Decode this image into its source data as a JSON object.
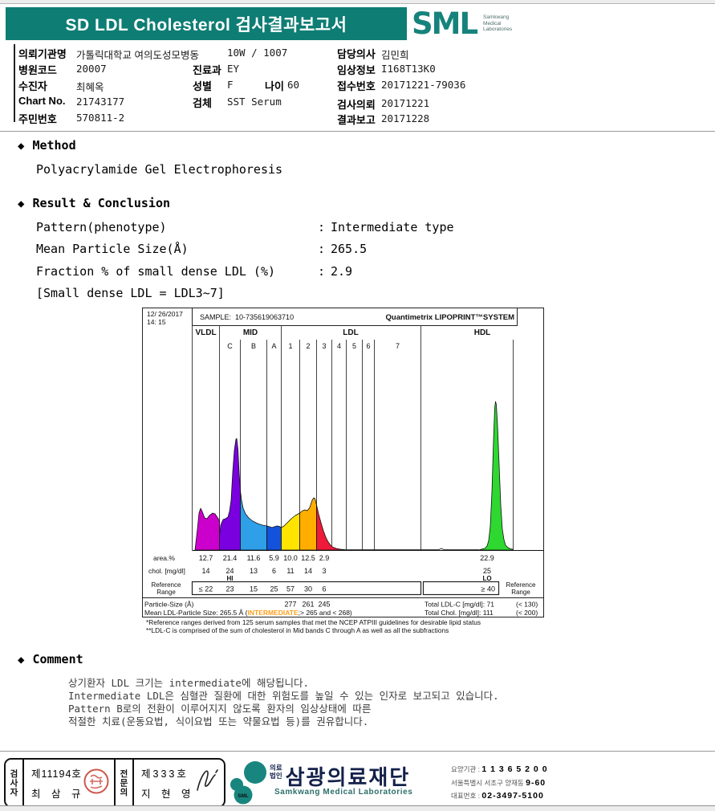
{
  "colors": {
    "teal": "#0e7d74",
    "magenta": "#e800e8",
    "navy": "#13204a",
    "flag_red": "#cc2222",
    "intermediate_orange": "#ff9f1a",
    "vldl": "#cc00cc",
    "mid_c": "#7a00e0",
    "mid_b": "#2f9fe8",
    "mid_a": "#1353dc",
    "ldl1": "#ffe400",
    "ldl2": "#ffae00",
    "ldl3": "#ef1939",
    "hdl": "#2ed830"
  },
  "header": {
    "title": "SD LDL Cholesterol 검사결과보고서",
    "logo_text": "SML",
    "logo_sub": [
      "Samkwang",
      "Medical",
      "Laboratories"
    ]
  },
  "patient": {
    "col1": [
      {
        "label": "의뢰기관명",
        "value": "가톨릭대학교 여의도성모병동",
        "extra": "10W / 1007"
      },
      {
        "label": "병원코드",
        "value": "20007"
      },
      {
        "label": "수진자",
        "value": "최혜옥"
      },
      {
        "label": "Chart No.",
        "value": "21743177"
      },
      {
        "label": "주민번호",
        "value": "570811-2"
      }
    ],
    "col2": [
      {
        "label": "진료과",
        "value": "EY"
      },
      {
        "label": "성별",
        "value": "F",
        "label2": "나이",
        "value2": "60"
      },
      {
        "label": "검체",
        "value": "SST Serum"
      }
    ],
    "col3": [
      {
        "label": "담당의사",
        "value": "김민희"
      },
      {
        "label": "임상정보",
        "value": "I168T13K0"
      },
      {
        "label": "접수번호",
        "value": "20171221-79036"
      },
      {
        "label": "검사의뢰",
        "value": "20171221"
      },
      {
        "label": "결과보고",
        "value": "20171228"
      }
    ]
  },
  "method": {
    "bullet": "◆",
    "heading": "Method",
    "value": "Polyacrylamide Gel Electrophoresis"
  },
  "result": {
    "bullet": "◆",
    "heading": "Result & Conclusion",
    "rows": [
      {
        "label": "Pattern(phenotype)",
        "colon": ":",
        "value": "Intermediate type"
      },
      {
        "label": "Mean Particle Size(Å)",
        "colon": ":",
        "value": "265.5"
      },
      {
        "label": "Fraction % of small dense LDL (%)",
        "colon": ":",
        "value": "2.9"
      }
    ],
    "note": "[Small dense LDL = LDL3~7]"
  },
  "chart_data": {
    "type": "area",
    "system_title": "Quantimetrix LIPOPRINT™SYSTEM",
    "printed_date": "12/ 26/2017",
    "printed_time": "14: 15",
    "sample_label": "SAMPLE:",
    "sample_id": "10-735619063710",
    "band_groups": [
      "VLDL",
      "MID",
      "LDL",
      "HDL"
    ],
    "sub_labels": [
      "C",
      "B",
      "A",
      "1",
      "2",
      "3",
      "4",
      "5",
      "6",
      "7"
    ],
    "fractions": [
      {
        "name": "VLDL",
        "area_pct": 12.7,
        "chol_mgdl": 14,
        "ref_range": "≤ 22",
        "color": "#cc00cc"
      },
      {
        "name": "MID C",
        "area_pct": 21.4,
        "chol_mgdl": 24,
        "flag": "HI",
        "ref_range": "23",
        "color": "#7a00e0"
      },
      {
        "name": "MID B",
        "area_pct": 11.6,
        "chol_mgdl": 13,
        "ref_range": "15",
        "color": "#2f9fe8"
      },
      {
        "name": "MID A",
        "area_pct": 5.9,
        "chol_mgdl": 6,
        "ref_range": "25",
        "color": "#1353dc"
      },
      {
        "name": "LDL 1",
        "area_pct": 10.0,
        "chol_mgdl": 11,
        "ref_range": "57",
        "particle_size_A": 277,
        "color": "#ffe400"
      },
      {
        "name": "LDL 2",
        "area_pct": 12.5,
        "chol_mgdl": 14,
        "ref_range": "30",
        "particle_size_A": 261,
        "color": "#ffae00"
      },
      {
        "name": "LDL 3",
        "area_pct": 2.9,
        "chol_mgdl": 3,
        "ref_range": "6",
        "particle_size_A": 245,
        "color": "#ef1939"
      },
      {
        "name": "HDL",
        "area_pct": 22.9,
        "chol_mgdl": 25,
        "flag": "LO",
        "ref_range": "≥ 40",
        "color": "#2ed830"
      }
    ],
    "rows": {
      "area": {
        "label": "area.%",
        "values": [
          "12.7",
          "21.4",
          "11.6",
          "5.9",
          "10.0",
          "12.5",
          "2.9",
          "22.9"
        ]
      },
      "chol": {
        "label": "chol. [mg/dl]",
        "values": [
          "14",
          "24",
          "13",
          "6",
          "11",
          "14",
          "3",
          "25"
        ],
        "hi_flag": "HI",
        "lo_flag": "LO"
      },
      "ref": {
        "label_line1": "Reference",
        "label_line2": "Range",
        "values": [
          "≤ 22",
          "23",
          "15",
          "25",
          "57",
          "30",
          "6"
        ],
        "hdl_value": "≥ 40"
      },
      "size": {
        "label": "Particle-Size (Å)",
        "values": [
          "277",
          "261",
          "245"
        ]
      }
    },
    "mean_row": {
      "part1": "Mean LDL-Particle Size:  265.5 Å (",
      "part2": "INTERMEDIATE",
      "part3": ";> 265 and < 268)"
    },
    "totals": {
      "ldl_label": "Total LDL-C [mg/dl]: 71",
      "ldl_ref": "(< 130)",
      "chol_label": "Total Chol. [mg/dl]:  111",
      "chol_ref": "(< 200)"
    },
    "footnotes": [
      "*Reference ranges derived from 125 serum samples that met the NCEP ATPIII guidelines for desirable lipid status",
      "**LDL-C is comprised of the sum of cholesterol in Mid bands C through A as well as all the subfractions"
    ]
  },
  "comment": {
    "bullet": "◆",
    "heading": "Comment",
    "lines": [
      "상기환자 LDL 크기는 intermediate에 해당됩니다.",
      "Intermediate LDL은 심혈관 질환에 대한 위험도를 높일 수 있는 인자로 보고되고 있습니다.",
      "Pattern B로의 전환이 이루어지지 않도록 환자의 임상상태에 따른",
      "적절한 치료(운동요법, 식이요법 또는 약물요법 등)를 권유합니다."
    ]
  },
  "footer": {
    "examiner": {
      "role": "검사자",
      "cert_no": "제11194호",
      "name": "최 삼 규"
    },
    "specialist": {
      "role": "전문의",
      "cert_no": "제333호",
      "name": "지 현 영"
    },
    "org": {
      "prefix_line1": "의료",
      "prefix_line2": "법인",
      "name": "삼광의료재단",
      "name_en": "Samkwang Medical Laboratories",
      "logo_text": "SML"
    },
    "info": [
      {
        "label": "요양기관 :",
        "value": "1 1 3 6 5 2 0 0"
      },
      {
        "label": "서울특별시 서초구 양재동",
        "value": "9-60"
      },
      {
        "label": "대표번호 :",
        "value": "02-3497-5100"
      }
    ]
  }
}
